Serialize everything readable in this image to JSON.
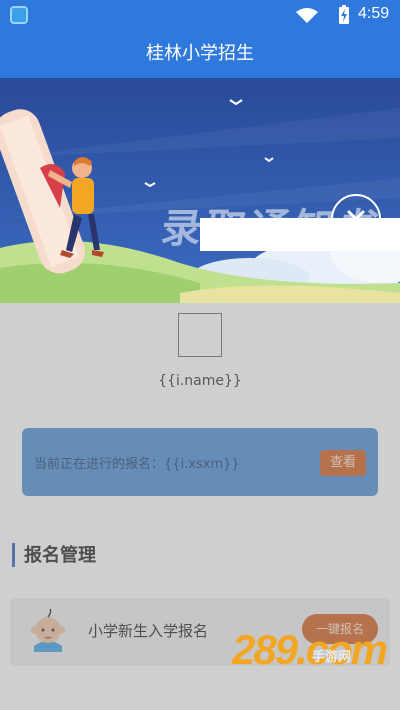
{
  "status_bar": {
    "time": "4:59"
  },
  "header": {
    "title": "桂林小学招生"
  },
  "banner": {
    "text": "录取通知书"
  },
  "profile": {
    "name_placeholder": "{{i.name}}"
  },
  "notice": {
    "text": "当前正在进行的报名：{{i.xsxm}}",
    "view_label": "查看"
  },
  "section": {
    "title": "报名管理"
  },
  "enroll_card": {
    "label": "小学新生入学报名",
    "button_label": "一键报名"
  },
  "watermark": {
    "main": "289.com",
    "sub": "手游网"
  },
  "colors": {
    "primary": "#2f78dc",
    "accent": "#d45e20",
    "notice_bg": "#4a8ed8"
  }
}
